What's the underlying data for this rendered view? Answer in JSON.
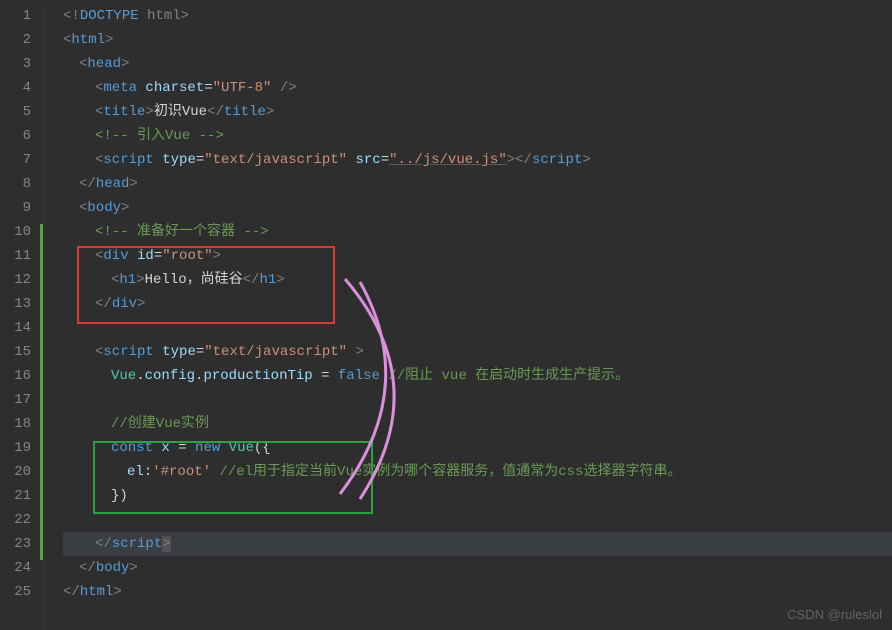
{
  "lines": [
    {
      "n": "1"
    },
    {
      "n": "2"
    },
    {
      "n": "3"
    },
    {
      "n": "4"
    },
    {
      "n": "5"
    },
    {
      "n": "6"
    },
    {
      "n": "7"
    },
    {
      "n": "8"
    },
    {
      "n": "9"
    },
    {
      "n": "10"
    },
    {
      "n": "11"
    },
    {
      "n": "12"
    },
    {
      "n": "13"
    },
    {
      "n": "14"
    },
    {
      "n": "15"
    },
    {
      "n": "16"
    },
    {
      "n": "17"
    },
    {
      "n": "18"
    },
    {
      "n": "19"
    },
    {
      "n": "20"
    },
    {
      "n": "21"
    },
    {
      "n": "22"
    },
    {
      "n": "23"
    },
    {
      "n": "24"
    },
    {
      "n": "25"
    }
  ],
  "tokens": {
    "lt": "<",
    "gt": ">",
    "slash": "/",
    "exclaim": "!",
    "dash": "--",
    "eq": "=",
    "sp": " ",
    "doctype": "DOCTYPE",
    "htmlword": "html",
    "html": "html",
    "head": "head",
    "meta": "meta",
    "title": "title",
    "script": "script",
    "body": "body",
    "div": "div",
    "h1": "h1",
    "charset": "charset",
    "utf8": "\"UTF-8\"",
    "type": "type",
    "textjs": "\"text/javascript\"",
    "src": "src",
    "vuejs": "\"../js/vue.js\"",
    "id": "id",
    "root": "\"root\"",
    "hello": "Hello，尚硅谷",
    "titleText": "初识Vue",
    "comment_vue": " 引入Vue ",
    "comment_container": " 准备好一个容器 ",
    "vue_ident": "Vue",
    "dot": ".",
    "config": "config",
    "productionTip": "productionTip",
    "false": "false",
    "line16_comment": "//阻止 vue 在启动时生成生产提示。",
    "line18_comment": "//创建Vue实例",
    "const": "const",
    "x": "x",
    "new": "new",
    "open": "({",
    "close": "})",
    "el": "el",
    "colon": ":",
    "rootstr": "'#root'",
    "line20_comment": "//el用于指定当前Vue实例为哪个容器服务，值通常为css选择器字符串。",
    "selfclose": " />"
  },
  "watermark": "CSDN @ruleslol"
}
